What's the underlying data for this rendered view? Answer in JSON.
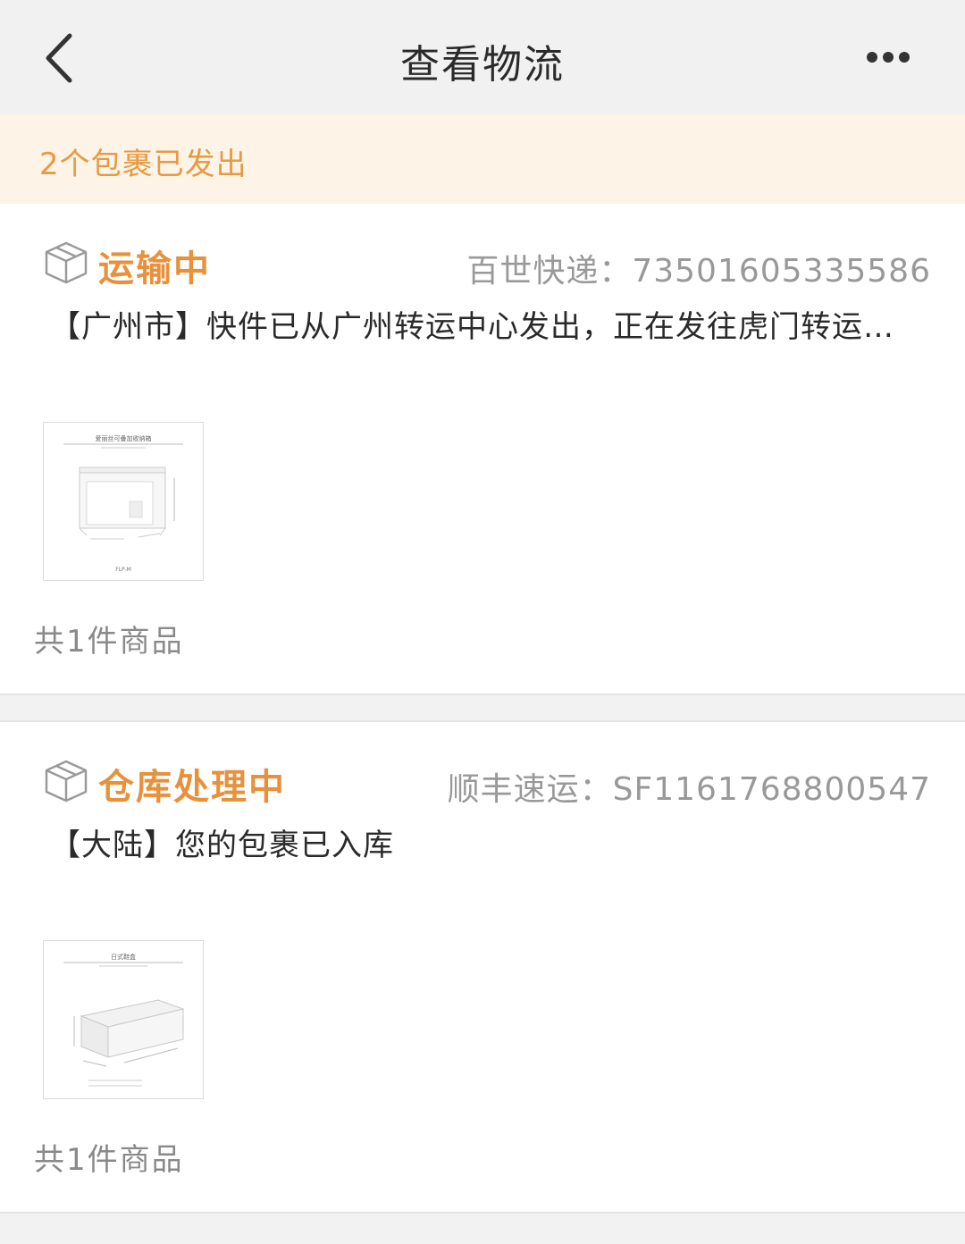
{
  "navbar": {
    "title": "查看物流",
    "back_icon": "chevron-left-icon",
    "more_icon": "more-dots-icon"
  },
  "banner": {
    "text": "2个包裹已发出"
  },
  "packages": [
    {
      "status": "运输中",
      "carrier": "百世快递：73501605335586",
      "description": "【广州市】快件已从广州转运中心发出，正在发往虎门转运…",
      "thumb_caption": "爱丽丝可叠加收纳箱",
      "thumb_code": "FLP-M",
      "item_count": "共1件商品"
    },
    {
      "status": "仓库处理中",
      "carrier": "顺丰速运：SF1161768800547",
      "description": "【大陆】您的包裹已入库",
      "thumb_caption": "日式鞋盒",
      "item_count": "共1件商品"
    }
  ],
  "colors": {
    "accent": "#e7913b",
    "banner_bg": "#fdf4e7",
    "banner_text": "#e79a43",
    "muted": "#999999"
  }
}
